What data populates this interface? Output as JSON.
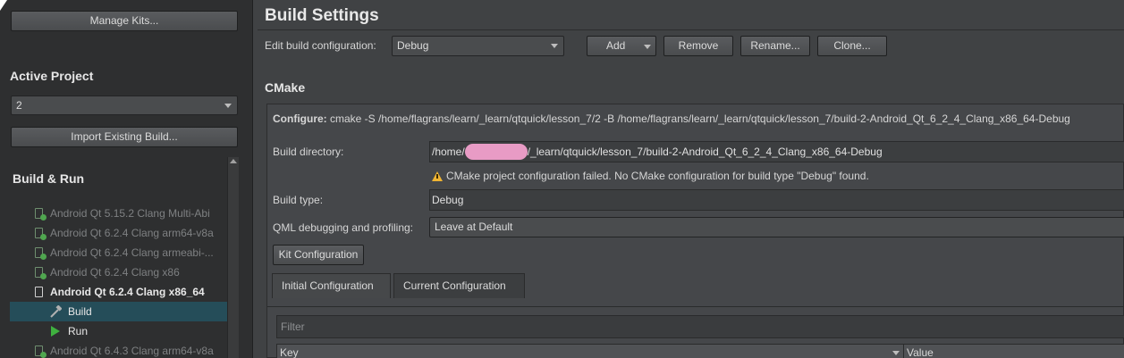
{
  "sidebar": {
    "manage_kits_label": "Manage Kits...",
    "active_project_heading": "Active Project",
    "active_project_value": "2",
    "import_build_label": "Import Existing Build...",
    "build_run_heading": "Build & Run",
    "kits": [
      {
        "label": "Android Qt 5.15.2 Clang Multi-Abi"
      },
      {
        "label": "Android Qt 6.2.4 Clang arm64-v8a"
      },
      {
        "label": "Android Qt 6.2.4 Clang armeabi-..."
      },
      {
        "label": "Android Qt 6.2.4 Clang x86"
      },
      {
        "label": "Android Qt 6.2.4 Clang x86_64"
      }
    ],
    "sub_items": [
      {
        "label": "Build"
      },
      {
        "label": "Run"
      }
    ],
    "next_kit_label": "Android Qt 6.4.3 Clang arm64-v8a"
  },
  "main": {
    "title": "Build Settings",
    "edit_config_label": "Edit build configuration:",
    "edit_config_value": "Debug",
    "add_label": "Add",
    "remove_label": "Remove",
    "rename_label": "Rename...",
    "clone_label": "Clone...",
    "cmake_heading": "CMake",
    "configure_label": "Configure:",
    "configure_command": "cmake -S /home/flagrans/learn/_learn/qtquick/lesson_7/2 -B /home/flagrans/learn/_learn/qtquick/lesson_7/build-2-Android_Qt_6_2_4_Clang_x86_64-Debug",
    "build_dir_label": "Build directory:",
    "build_dir_prefix": "/home/",
    "build_dir_suffix": "/_learn/qtquick/lesson_7/build-2-Android_Qt_6_2_4_Clang_x86_64-Debug",
    "warning_text": "CMake project configuration failed. No CMake configuration for build type \"Debug\" found.",
    "build_type_label": "Build type:",
    "build_type_value": "Debug",
    "qml_debug_label": "QML debugging and profiling:",
    "qml_debug_value": "Leave at Default",
    "kit_config_label": "Kit Configuration",
    "tabs": [
      {
        "label": "Initial Configuration"
      },
      {
        "label": "Current Configuration"
      }
    ],
    "filter_placeholder": "Filter",
    "table_headers": {
      "key": "Key",
      "value": "Value"
    }
  },
  "colors": {
    "selected_row": "#254d59",
    "warning": "#f0b432",
    "run_icon": "#3fb13f",
    "redaction": "#e89bc5"
  }
}
